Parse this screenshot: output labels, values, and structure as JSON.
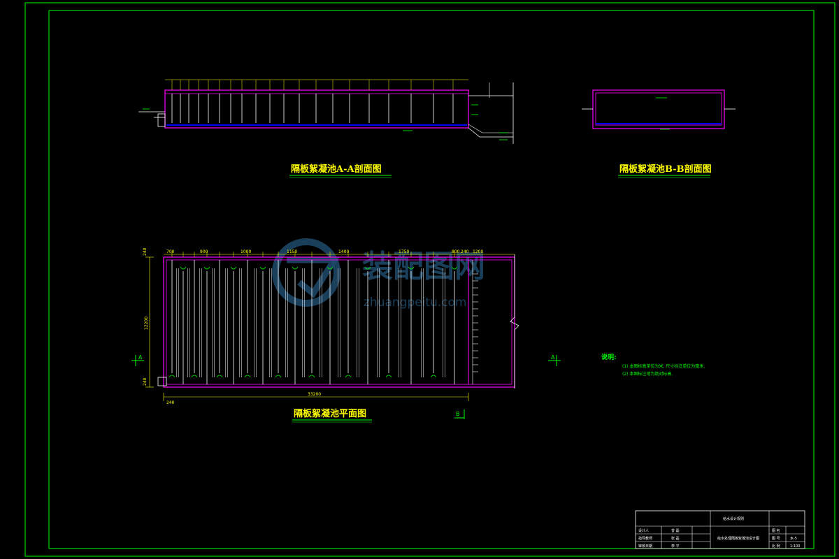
{
  "drawing": {
    "titles": {
      "section_aa": "隔板絮凝池A-A剖面图",
      "section_bb": "隔板絮凝池B-B剖面图",
      "plan": "隔板絮凝池平面图"
    },
    "plan_dimensions": {
      "top_labels": [
        "700",
        "900",
        "1000",
        "1150",
        "1400",
        "1750",
        "800",
        "1200",
        "240"
      ],
      "width_overall": "33200",
      "height_overall": "12200",
      "left_top": "240",
      "left_bottom": "240",
      "bottom_left": "240"
    },
    "section_marks": {
      "a_left": "A",
      "a_right": "A",
      "b_bottom": "B"
    },
    "notes": {
      "heading": "说明:",
      "lines": [
        "(1) 本图标高单位为米, 尺寸标注单位为毫米.",
        "(2) 本图标注地为绝对标高."
      ]
    },
    "watermark": {
      "main": "装配图网",
      "sub": "zhuangpeitu.com"
    },
    "title_block": {
      "org": "给水设计规则",
      "rows": [
        [
          "设计人",
          "曾 磊"
        ],
        [
          "指导教师",
          "张 磊"
        ],
        [
          "审核日期",
          "李 平"
        ]
      ],
      "drawing_name": "给水处理隔板絮凝池设计图",
      "right": [
        [
          "图 名",
          ""
        ],
        [
          "图 号",
          "水-5"
        ],
        [
          "比 例",
          "1:100"
        ]
      ]
    }
  },
  "colors": {
    "background": "#000000",
    "frame": "#00ff00",
    "tank_walls": "#ff00ff",
    "baffles": "#ffffff",
    "water": "#0000ff",
    "text": "#ffff00"
  }
}
